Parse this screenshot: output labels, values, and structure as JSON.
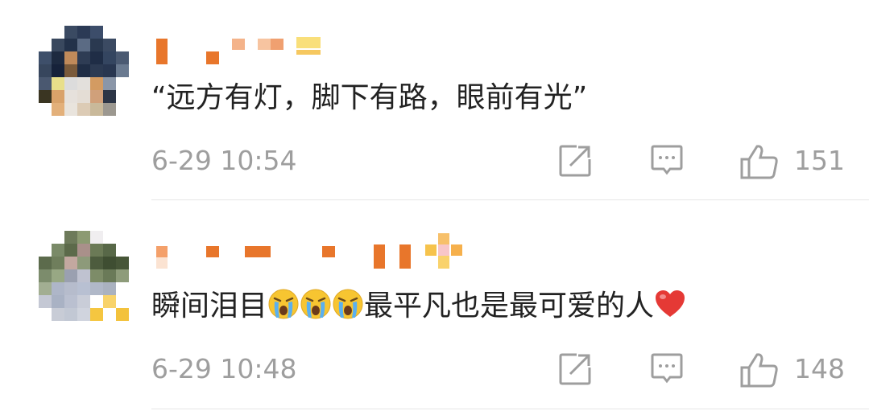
{
  "comments": [
    {
      "text": "“远方有灯，脚下有路，眼前有光”",
      "time": "6-29 10:54",
      "likes": "151"
    },
    {
      "text_before": "瞬间泪目",
      "text_after": "最平凡也是最可爱的人",
      "crying_emoji_count": 3,
      "time": "6-29 10:48",
      "likes": "148"
    }
  ],
  "icons": [
    "share-icon",
    "reply-icon",
    "like-icon",
    "crying-face-emoji-icon",
    "heart-emoji-icon"
  ],
  "colors": {
    "text": "#222222",
    "meta": "#9e9e9e",
    "divider": "#e6e6e6",
    "username_blur": "#e8762b",
    "heart": "#e53935"
  }
}
